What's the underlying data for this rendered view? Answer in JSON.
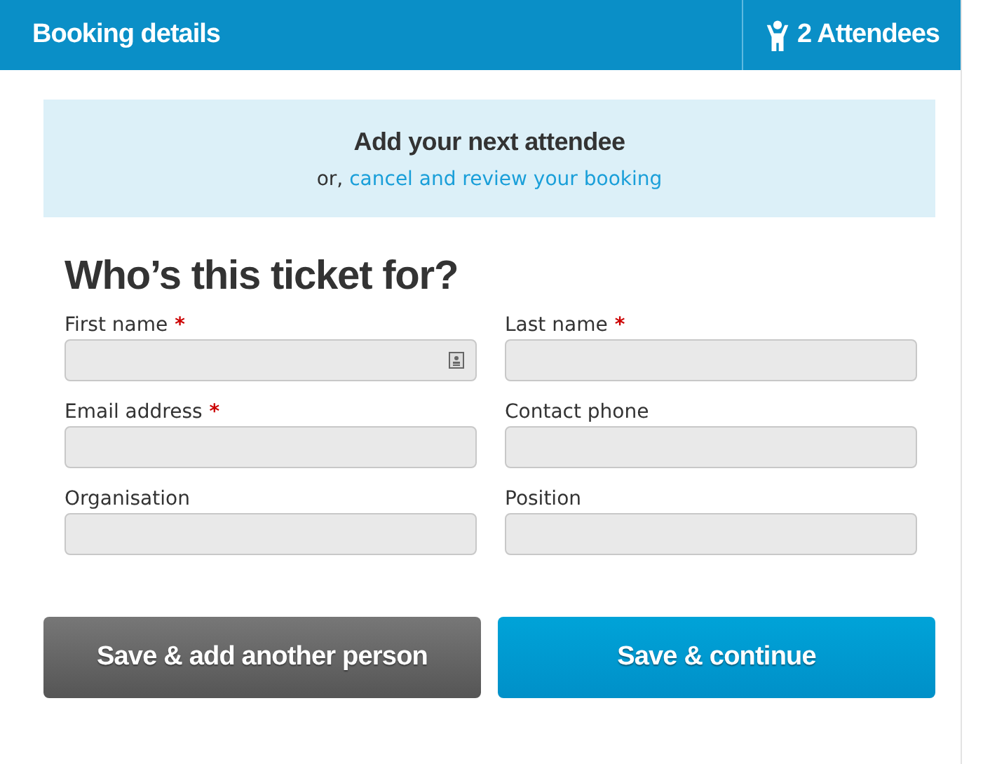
{
  "header": {
    "title": "Booking details",
    "attendees": "2 Attendees"
  },
  "notice": {
    "title": "Add your next attendee",
    "prefix": "or,",
    "link": "cancel and review your booking"
  },
  "form": {
    "heading": "Who’s this ticket for?",
    "fields": [
      {
        "label": "First name",
        "required_mark": "*",
        "has_icon": true
      },
      {
        "label": "Last name",
        "required_mark": "*",
        "has_icon": false
      },
      {
        "label": "Email address",
        "required_mark": "*",
        "has_icon": false
      },
      {
        "label": "Contact phone",
        "has_icon": false
      },
      {
        "label": "Organisation",
        "has_icon": false
      },
      {
        "label": "Position",
        "has_icon": false
      }
    ]
  },
  "buttons": [
    {
      "label": "Save & add another person",
      "kind": "secondary"
    },
    {
      "label": "Save & continue",
      "kind": "primary"
    }
  ]
}
